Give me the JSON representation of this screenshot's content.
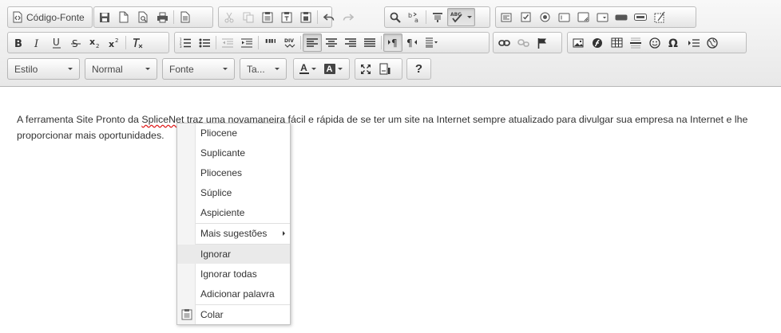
{
  "toolbar": {
    "source_label": "Código-Fonte",
    "styles_combo": "Estilo",
    "format_combo": "Normal",
    "font_combo": "Fonte",
    "size_combo": "Ta...",
    "text_color_letter": "A",
    "bg_color_letter": "A",
    "help_label": "?",
    "icons": {
      "row1": [
        "source-icon",
        "save-icon",
        "new-page-icon",
        "preview-icon",
        "print-icon",
        "templates-icon",
        "cut-icon",
        "copy-icon",
        "paste-icon",
        "paste-text-icon",
        "paste-word-icon",
        "undo-icon",
        "redo-icon",
        "find-icon",
        "replace-icon",
        "select-all-icon",
        "spellcheck-icon",
        "form-icon",
        "checkbox-icon",
        "radio-icon",
        "text-field-icon",
        "textarea-icon",
        "select-field-icon",
        "button-field-icon",
        "image-button-icon",
        "hidden-field-icon"
      ],
      "row2": [
        "bold-icon",
        "italic-icon",
        "underline-icon",
        "strike-icon",
        "subscript-icon",
        "superscript-icon",
        "remove-format-icon",
        "numbered-list-icon",
        "bulleted-list-icon",
        "outdent-icon",
        "indent-icon",
        "blockquote-icon",
        "div-icon",
        "align-left-icon",
        "align-center-icon",
        "align-right-icon",
        "justify-icon",
        "ltr-icon",
        "rtl-icon",
        "language-icon",
        "link-icon",
        "unlink-icon",
        "anchor-icon",
        "image-icon",
        "flash-icon",
        "table-icon",
        "horizontal-rule-icon",
        "smiley-icon",
        "special-char-icon",
        "page-break-icon",
        "iframe-icon"
      ],
      "row3": [
        "maximize-icon",
        "show-blocks-icon"
      ]
    }
  },
  "editor": {
    "paragraph_before": "A ferramenta Site Pronto da ",
    "misspelled_word": "SpliceNet",
    "paragraph_after": " traz uma novamaneira fácil e rápida de se ter um site na Internet sempre atualizado para divulgar sua empresa na Internet e lhe proporcionar mais oportunidades."
  },
  "context_menu": {
    "suggestions": [
      "Pliocene",
      "Suplicante",
      "Pliocenes",
      "Súplice",
      "Aspiciente"
    ],
    "more_suggestions": "Mais sugestões",
    "ignore": "Ignorar",
    "ignore_all": "Ignorar todas",
    "add_word": "Adicionar palavra",
    "paste": "Colar",
    "paste_icon": "clipboard-icon"
  }
}
